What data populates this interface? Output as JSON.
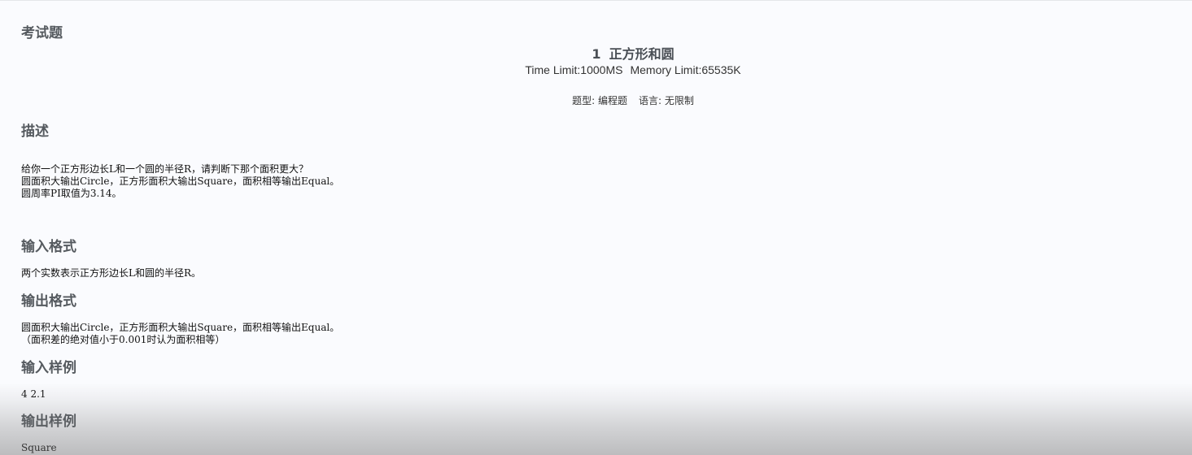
{
  "section": {
    "title": "考试题"
  },
  "problem": {
    "number": "1",
    "name": "正方形和圆",
    "time_limit": "Time Limit:1000MS",
    "memory_limit": "Memory Limit:65535K",
    "type": "题型: 编程题",
    "language": "语言: 无限制"
  },
  "description": {
    "heading": "描述",
    "lines": [
      "给你一个正方形边长L和一个圆的半径R，请判断下那个面积更大？",
      "圆面积大输出Circle，正方形面积大输出Square，面积相等输出Equal。",
      "圆周率PI取值为3.14。"
    ]
  },
  "input_format": {
    "heading": "输入格式",
    "text": "两个实数表示正方形边长L和圆的半径R。"
  },
  "output_format": {
    "heading": "输出格式",
    "lines": [
      "圆面积大输出Circle，正方形面积大输出Square，面积相等输出Equal。",
      "（面积差的绝对值小于0.001时认为面积相等）"
    ]
  },
  "input_sample": {
    "heading": "输入样例",
    "text": "4 2.1"
  },
  "output_sample": {
    "heading": "输出样例",
    "text": "Square"
  }
}
